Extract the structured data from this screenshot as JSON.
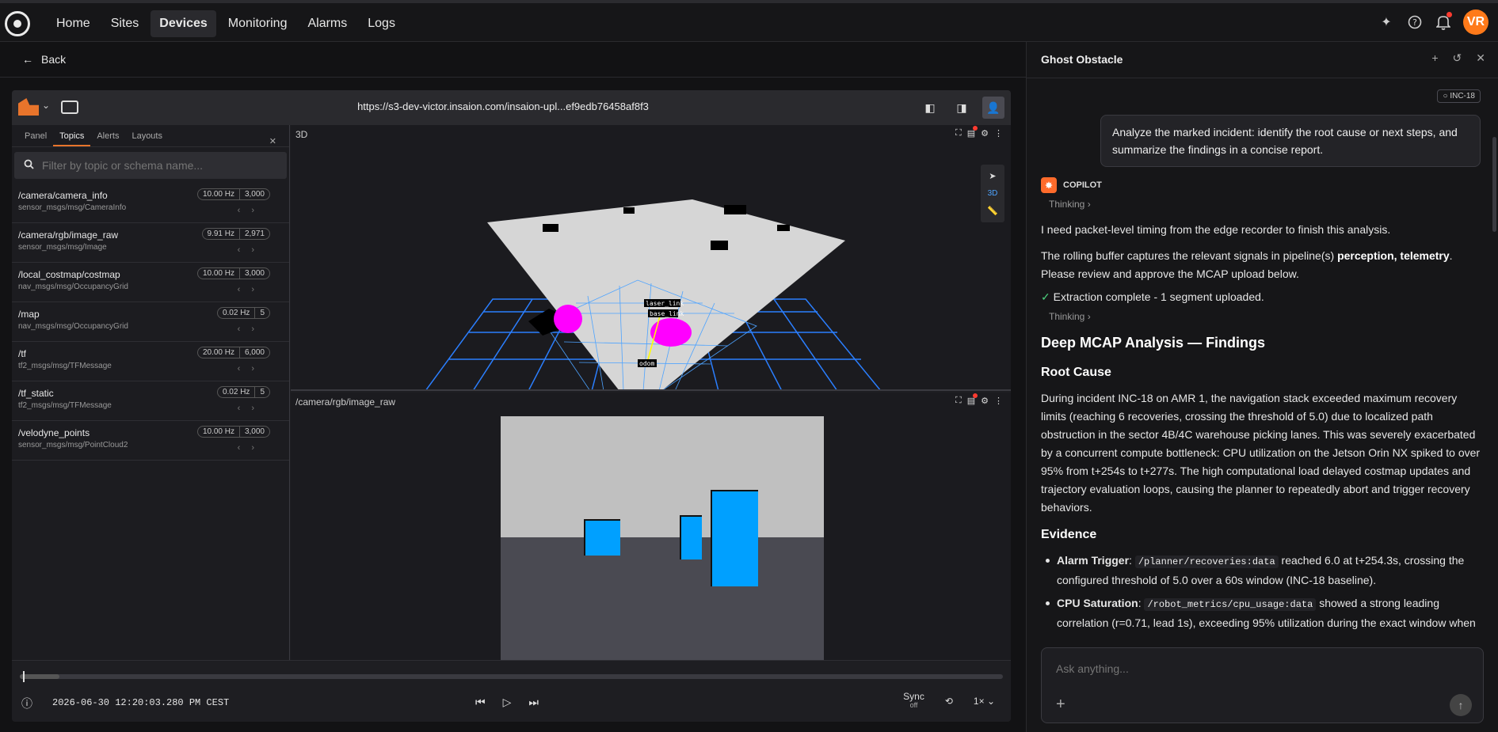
{
  "nav": {
    "items": [
      "Home",
      "Sites",
      "Devices",
      "Monitoring",
      "Alarms",
      "Logs"
    ],
    "active": "Devices",
    "avatar": "VR"
  },
  "back_label": "Back",
  "viewer": {
    "url": "https://s3-dev-victor.insaion.com/insaion-upl...ef9edb76458af8f3",
    "panel_tabs": [
      "Panel",
      "Topics",
      "Alerts",
      "Layouts"
    ],
    "active_tab": "Topics",
    "search_placeholder": "Filter by topic or schema name...",
    "topics": [
      {
        "name": "/camera/camera_info",
        "schema": "sensor_msgs/msg/CameraInfo",
        "hz": "10.00 Hz",
        "count": "3,000"
      },
      {
        "name": "/camera/rgb/image_raw",
        "schema": "sensor_msgs/msg/Image",
        "hz": "9.91 Hz",
        "count": "2,971"
      },
      {
        "name": "/local_costmap/costmap",
        "schema": "nav_msgs/msg/OccupancyGrid",
        "hz": "10.00 Hz",
        "count": "3,000"
      },
      {
        "name": "/map",
        "schema": "nav_msgs/msg/OccupancyGrid",
        "hz": "0.02 Hz",
        "count": "5"
      },
      {
        "name": "/tf",
        "schema": "tf2_msgs/msg/TFMessage",
        "hz": "20.00 Hz",
        "count": "6,000"
      },
      {
        "name": "/tf_static",
        "schema": "tf2_msgs/msg/TFMessage",
        "hz": "0.02 Hz",
        "count": "5"
      },
      {
        "name": "/velodyne_points",
        "schema": "sensor_msgs/msg/PointCloud2",
        "hz": "10.00 Hz",
        "count": "3,000"
      }
    ],
    "panel3d_caption": "3D",
    "side_3d_label": "3D",
    "camera_caption": "/camera/rgb/image_raw",
    "scene_labels": [
      "laser_link",
      "base_link",
      "odom"
    ],
    "timestamp": "2026-06-30 12:20:03.280 PM CEST",
    "sync_label": "Sync",
    "sync_state": "off",
    "speed": "1×"
  },
  "copilot": {
    "title": "Ghost Obstacle",
    "incident_tag": "INC-18",
    "user_message": "Analyze the marked incident: identify the root cause or next steps, and summarize the findings in a concise report.",
    "assistant_label": "COPILOT",
    "thinking": "Thinking",
    "p1": "I need packet-level timing from the edge recorder to finish this analysis.",
    "p2_pre": "The rolling buffer captures the relevant signals in pipeline(s) ",
    "p2_bold": "perception, telemetry",
    "p2_post": ". Please review and approve the MCAP upload below.",
    "extraction": "Extraction complete - 1 segment uploaded.",
    "h_findings": "Deep MCAP Analysis — Findings",
    "h_root": "Root Cause",
    "root_text": "During incident INC-18 on AMR 1, the navigation stack exceeded maximum recovery limits (reaching 6 recoveries, crossing the threshold of 5.0) due to localized path obstruction in the sector 4B/4C warehouse picking lanes. This was severely exacerbated by a concurrent compute bottleneck: CPU utilization on the Jetson Orin NX spiked to over 95% from t+254s to t+277s. The high computational load delayed costmap updates and trajectory evaluation loops, causing the planner to repeatedly abort and trigger recovery behaviors.",
    "h_evidence": "Evidence",
    "ev1_label": "Alarm Trigger",
    "ev1_code": "/planner/recoveries:data",
    "ev1_text": "reached 6.0 at t+254.3s, crossing the configured threshold of 5.0 over a 60s window (INC-18 baseline).",
    "ev2_label": "CPU Saturation",
    "ev2_code": "/robot_metrics/cpu_usage:data",
    "ev2_text": "showed a strong leading correlation (r=0.71, lead 1s), exceeding 95% utilization during the exact window when",
    "input_placeholder": "Ask anything..."
  },
  "colors": {
    "accent": "#e8742b",
    "avatar": "#ff7a1a",
    "grid": "#2b7fff",
    "obstacle": "#ff00ff",
    "box": "#00a0ff"
  }
}
